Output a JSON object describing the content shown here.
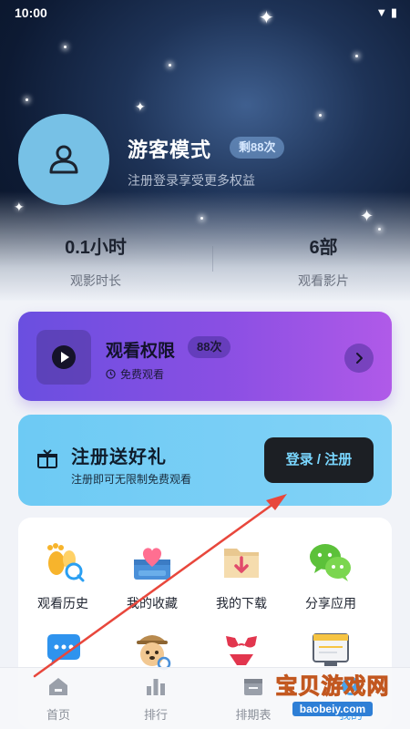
{
  "status_bar": {
    "time": "10:00",
    "right": "▼ ▮"
  },
  "profile": {
    "title": "游客模式",
    "badge": "剩88次",
    "subtitle": "注册登录享受更多权益"
  },
  "stats": [
    {
      "value": "0.1小时",
      "label": "观影时长"
    },
    {
      "value": "6部",
      "label": "观看影片"
    }
  ],
  "watch_card": {
    "title": "观看权限",
    "badge": "88次",
    "subtitle": "免费观看"
  },
  "register_card": {
    "title": "注册送好礼",
    "subtitle": "注册即可无限制免费观看",
    "button": "登录 / 注册"
  },
  "menu": {
    "row1": [
      {
        "label": "观看历史",
        "icon": "footprints-icon"
      },
      {
        "label": "我的收藏",
        "icon": "heart-box-icon"
      },
      {
        "label": "我的下载",
        "icon": "download-folder-icon"
      },
      {
        "label": "分享应用",
        "icon": "wechat-icon"
      }
    ]
  },
  "bottom_nav": [
    {
      "label": "首页",
      "icon": "home-icon"
    },
    {
      "label": "排行",
      "icon": "ranking-icon"
    },
    {
      "label": "排期表",
      "icon": "schedule-icon"
    },
    {
      "label": "我的",
      "icon": "profile-icon",
      "active": true
    }
  ],
  "watermark": {
    "main": "宝贝游戏网",
    "sub": "baobeiy.com"
  },
  "colors": {
    "accent": "#4ba3ea",
    "watch_start": "#6a4fe0",
    "watch_end": "#b05ae8",
    "register": "#6dcaf4",
    "annotation_arrow": "#e8473c"
  }
}
